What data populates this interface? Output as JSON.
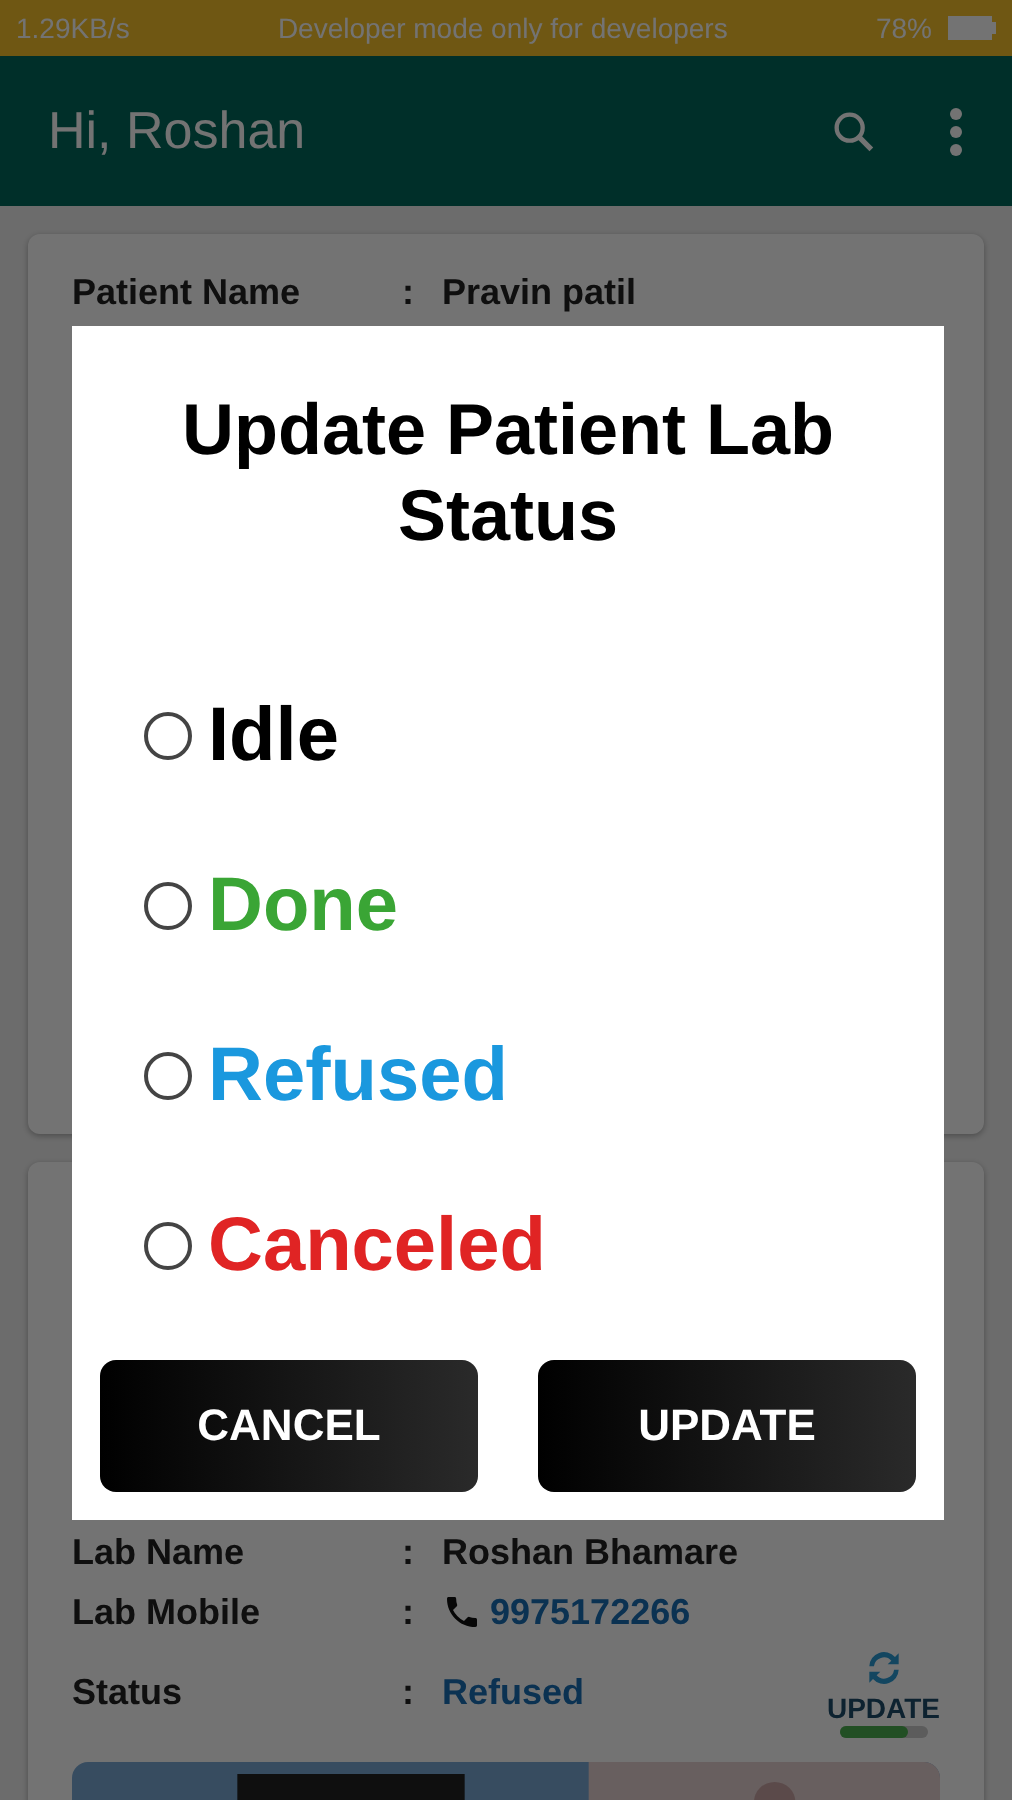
{
  "status_bar": {
    "speed": "1.29KB/s",
    "notice": "Developer mode only for developers",
    "battery": "78%"
  },
  "app_bar": {
    "title": "Hi, Roshan"
  },
  "cards": [
    {
      "rows": [
        {
          "label": "Patient Name",
          "separator": ":",
          "value": "Pravin patil",
          "kind": "text"
        }
      ]
    },
    {
      "rows": [
        {
          "label": "Lab Name",
          "separator": ":",
          "value": "Roshan Bhamare",
          "kind": "text"
        },
        {
          "label": "Lab Mobile",
          "separator": ":",
          "value": "9975172266",
          "kind": "phone"
        },
        {
          "label": "Status",
          "separator": ":",
          "value": "Refused",
          "kind": "status"
        }
      ],
      "update_label": "UPDATE"
    }
  ],
  "dialog": {
    "title": "Update Patient Lab Status",
    "options": [
      {
        "label": "Idle",
        "color": "#000000",
        "selected": false
      },
      {
        "label": "Done",
        "color": "#3aa535",
        "selected": false
      },
      {
        "label": "Refused",
        "color": "#1a98de",
        "selected": false
      },
      {
        "label": "Canceled",
        "color": "#e02424",
        "selected": false
      }
    ],
    "buttons": [
      "CANCEL",
      "UPDATE"
    ]
  }
}
